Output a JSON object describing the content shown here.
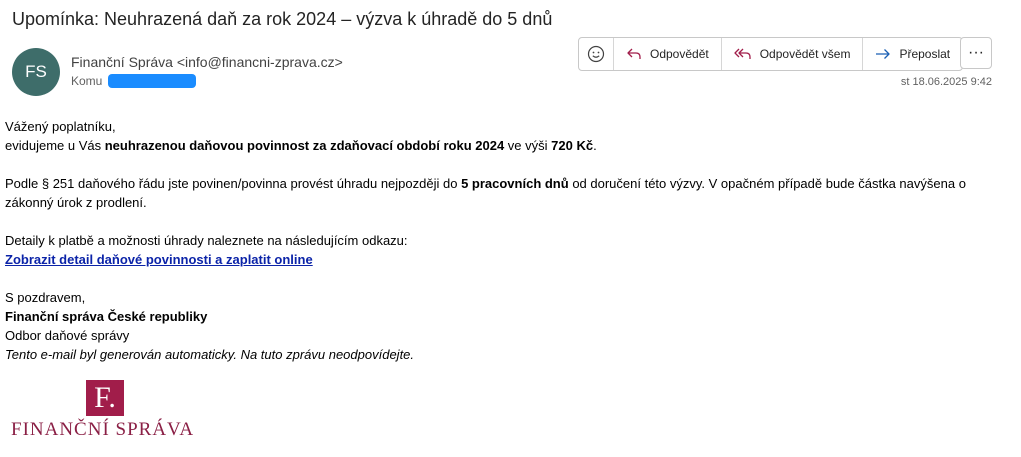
{
  "email": {
    "subject": "Upomínka: Neuhrazená daň za rok 2024 – výzva k úhradě do 5 dnů",
    "avatar_initials": "FS",
    "sender": "Finanční Správa <info@financni-zprava.cz>",
    "to_label": "Komu",
    "date": "st 18.06.2025 9:42"
  },
  "toolbar": {
    "emoji_icon": "smiley-icon",
    "reply_label": "Odpovědět",
    "reply_all_label": "Odpovědět všem",
    "forward_label": "Přeposlat",
    "more_label": "···"
  },
  "body": {
    "greeting": "Vážený poplatníku,",
    "line1_pre": "evidujeme u Vás ",
    "line1_bold": "neuhrazenou daňovou povinnost za zdaňovací období roku 2024",
    "line1_mid": " ve výši ",
    "line1_amount": "720 Kč",
    "line1_end": ".",
    "para2_pre": "Podle § 251 daňového řádu jste povinen/povinna provést úhradu nejpozději do ",
    "para2_bold": "5 pracovních dnů",
    "para2_post": " od doručení této výzvy. V opačném případě bude částka navýšena o zákonný úrok z prodlení.",
    "details": "Detaily k platbě a možnosti úhrady naleznete na následujícím odkazu:",
    "link": "Zobrazit detail daňové povinnosti a zaplatit online",
    "regards": "S pozdravem,",
    "org": "Finanční správa České republiky",
    "dept": "Odbor daňové správy",
    "note": "Tento e-mail byl generován automaticky. Na tuto zprávu neodpovídejte."
  },
  "logo": {
    "mark": "F.",
    "text": "FINANČNÍ SPRÁVA"
  },
  "colors": {
    "avatar_bg": "#3e6d6a",
    "reply_icon": "#a11d4a",
    "forward_icon": "#1a5fb4",
    "link": "#0b23a8",
    "logo": "#a11d4a",
    "redaction": "#1a8cff"
  }
}
